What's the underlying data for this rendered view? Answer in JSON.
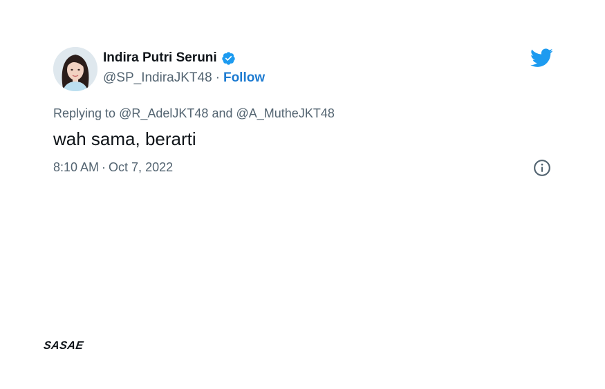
{
  "tweet": {
    "author": {
      "display_name": "Indira Putri Seruni",
      "handle": "@SP_IndiraJKT48",
      "separator": "·",
      "follow_label": "Follow",
      "verified": true
    },
    "replying": {
      "prefix": "Replying to",
      "mention_1": "@R_AdelJKT48",
      "conjunction": "and",
      "mention_2": "@A_MutheJKT48"
    },
    "text": "wah sama, berarti",
    "time": "8:10 AM",
    "date_separator": "·",
    "date": "Oct 7, 2022"
  },
  "watermark": "SASAE",
  "colors": {
    "accent": "#1d9bf0",
    "follow": "#1d7bd1",
    "secondary_text": "#536471",
    "primary_text": "#0f1419"
  },
  "icons": {
    "logo": "twitter-bird-icon",
    "verified": "verified-badge-icon",
    "info": "info-icon"
  }
}
